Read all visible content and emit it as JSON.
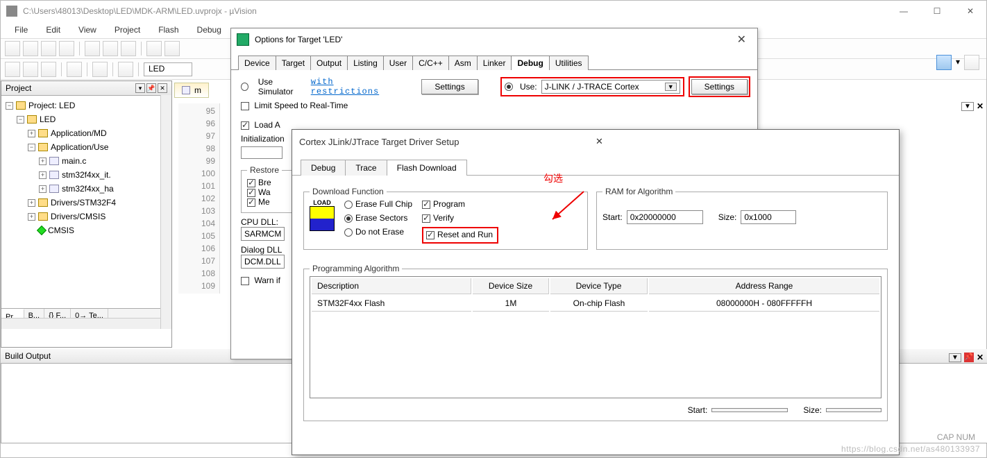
{
  "main": {
    "title": "C:\\Users\\48013\\Desktop\\LED\\MDK-ARM\\LED.uvprojx - µVision",
    "menu": [
      "File",
      "Edit",
      "View",
      "Project",
      "Flash",
      "Debug"
    ],
    "target_combo": "LED"
  },
  "project": {
    "header": "Project",
    "root": "Project: LED",
    "target": "LED",
    "groups": [
      {
        "name": "Application/MD",
        "expanded": false
      },
      {
        "name": "Application/Use",
        "expanded": true,
        "files": [
          "main.c",
          "stm32f4xx_it.",
          "stm32f4xx_ha"
        ]
      },
      {
        "name": "Drivers/STM32F4",
        "expanded": false
      },
      {
        "name": "Drivers/CMSIS",
        "expanded": false
      }
    ],
    "cmsis": "CMSIS",
    "tabs": [
      "Pr...",
      "B...",
      "{} F...",
      "0→ Te..."
    ]
  },
  "editor": {
    "tab": "m",
    "lines": [
      "95",
      "96",
      "97",
      "98",
      "99",
      "100",
      "101",
      "102",
      "103",
      "104",
      "105",
      "106",
      "107",
      "108",
      "109"
    ]
  },
  "build": {
    "header": "Build Output"
  },
  "options": {
    "title": "Options for Target 'LED'",
    "tabs": [
      "Device",
      "Target",
      "Output",
      "Listing",
      "User",
      "C/C++",
      "Asm",
      "Linker",
      "Debug",
      "Utilities"
    ],
    "active_tab": "Debug",
    "use_simulator": "Use Simulator",
    "with_restrictions": "with restrictions",
    "settings_btn": "Settings",
    "limit_speed": "Limit Speed to Real-Time",
    "use": "Use:",
    "debugger": "J-LINK / J-TRACE Cortex",
    "load_app": "Load A",
    "init": "Initialization",
    "restore": "Restore",
    "bre": "Bre",
    "wa": "Wa",
    "me": "Me",
    "cpu_dll": "CPU DLL:",
    "cpu_dll_val": "SARMCM",
    "dialog_dll": "Dialog DLL",
    "dialog_dll_val": "DCM.DLL",
    "warn": "Warn if"
  },
  "jlink": {
    "title": "Cortex JLink/JTrace Target Driver Setup",
    "tabs": [
      "Debug",
      "Trace",
      "Flash Download"
    ],
    "active_tab": "Flash Download",
    "download_fn": "Download Function",
    "load": "LOAD",
    "erase_full": "Erase Full Chip",
    "erase_sectors": "Erase Sectors",
    "do_not_erase": "Do not Erase",
    "program": "Program",
    "verify": "Verify",
    "reset_run": "Reset and Run",
    "ram_algo": "RAM for Algorithm",
    "start": "Start:",
    "start_val": "0x20000000",
    "size": "Size:",
    "size_val": "0x1000",
    "prog_algo": "Programming Algorithm",
    "th": [
      "Description",
      "Device Size",
      "Device Type",
      "Address Range"
    ],
    "row": [
      "STM32F4xx Flash",
      "1M",
      "On-chip Flash",
      "08000000H - 080FFFFFH"
    ],
    "start2": "Start:",
    "size2": "Size:"
  },
  "anno": {
    "check": "勾选"
  },
  "status": {
    "cap": "CAP  NUM"
  },
  "watermark": "https://blog.csdn.net/as480133937"
}
